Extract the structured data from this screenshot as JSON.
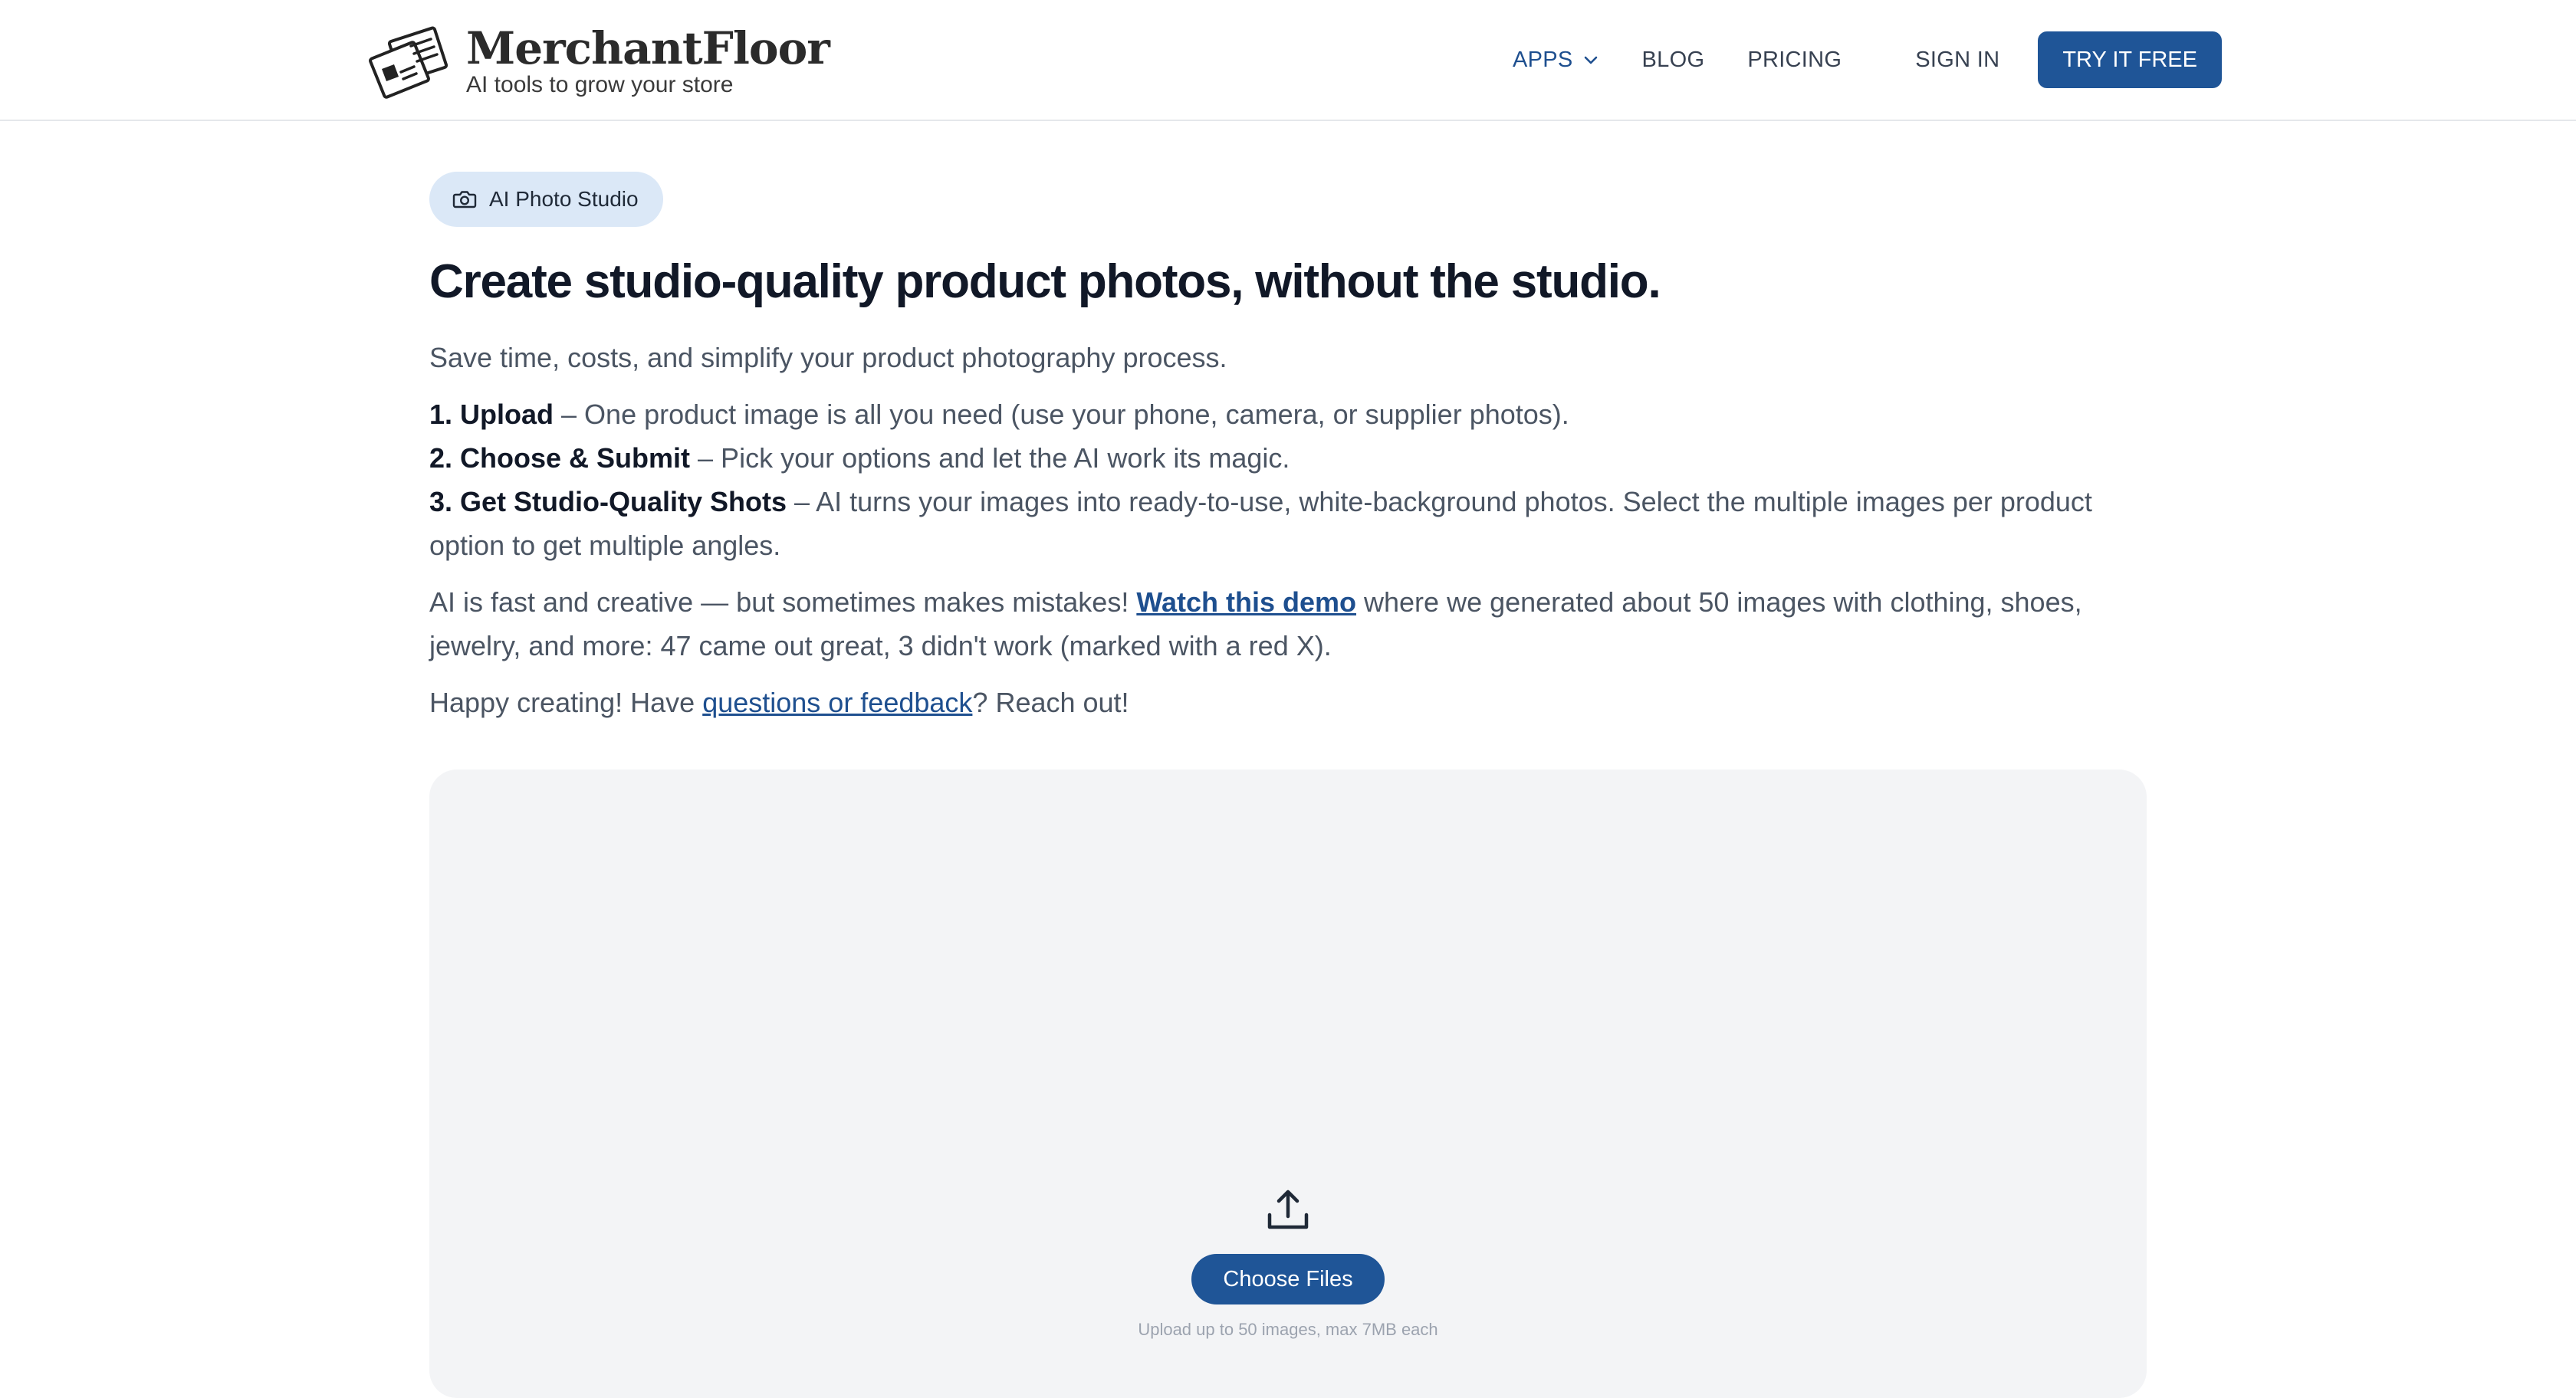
{
  "header": {
    "brand_name": "MerchantFloor",
    "brand_tagline": "AI tools to grow your store",
    "nav": {
      "apps": "APPS",
      "blog": "BLOG",
      "pricing": "PRICING",
      "sign_in": "SIGN IN",
      "try_free": "TRY IT FREE"
    }
  },
  "main": {
    "badge": "AI Photo Studio",
    "title": "Create studio-quality product photos, without the studio.",
    "intro": "Save time, costs, and simplify your product photography process.",
    "steps": [
      {
        "label": "1. Upload",
        "text": " – One product image is all you need (use your phone, camera, or supplier photos)."
      },
      {
        "label": "2. Choose & Submit",
        "text": " – Pick your options and let the AI work its magic."
      },
      {
        "label": "3. Get Studio-Quality Shots",
        "text": " – AI turns your images into ready-to-use, white-background photos. Select the multiple images per product option to get multiple angles."
      }
    ],
    "ai_note": {
      "before": "AI is fast and creative — but sometimes makes mistakes! ",
      "link": "Watch this demo",
      "after": " where we generated about 50 images with clothing, shoes, jewelry, and more: 47 came out great, 3 didn't work (marked with a red X)."
    },
    "happy": {
      "before": "Happy creating! Have ",
      "link": "questions or feedback",
      "after": "? Reach out!"
    }
  },
  "upload": {
    "button": "Choose Files",
    "hint": "Upload up to 50 images, max 7MB each"
  },
  "colors": {
    "primary": "#1f5597",
    "link": "#1e4f8f",
    "badge_bg": "#dbe8f7",
    "dropzone_bg": "#f3f4f6"
  },
  "icons": {
    "logo": "newspaper-logo-icon",
    "apps_dropdown": "chevron-down-icon",
    "badge": "camera-icon",
    "upload": "upload-icon"
  }
}
